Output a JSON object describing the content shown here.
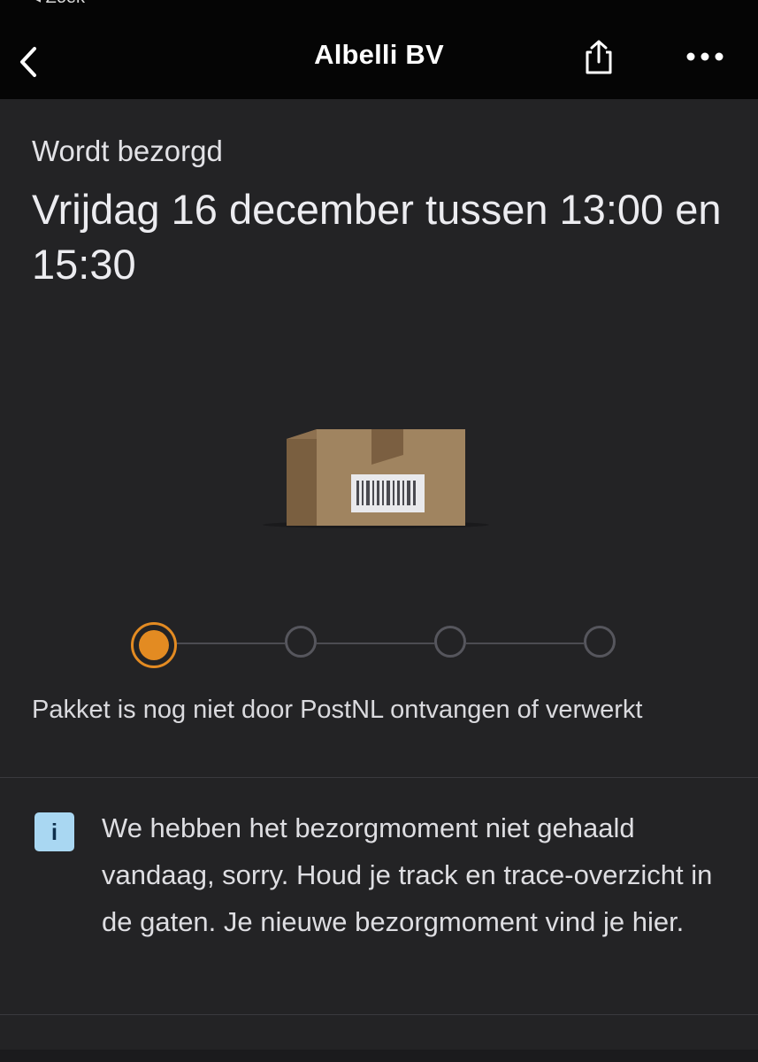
{
  "status_bar": {
    "back_label": "◂ Zoek"
  },
  "header": {
    "title": "Albelli BV",
    "back_icon": "chevron-left-icon",
    "share_icon": "share-icon",
    "more_icon": "more-horizontal-icon"
  },
  "delivery": {
    "status_label": "Wordt bezorgd",
    "time_window": "Vrijdag 16 december tussen 13:00 en 15:30"
  },
  "illustration": {
    "icon": "package-icon"
  },
  "progress": {
    "current_step": 1,
    "total_steps": 4,
    "active_color": "#e38b22",
    "status_text": "Pakket is nog niet door PostNL ontvangen of verwerkt"
  },
  "notice": {
    "icon": "info-icon",
    "icon_glyph": "i",
    "text": "We hebben het bezorgmoment niet gehaald vandaag, sorry. Houd je track en trace-overzicht in de gaten. Je nieuwe bezorgmoment vind je hier."
  }
}
